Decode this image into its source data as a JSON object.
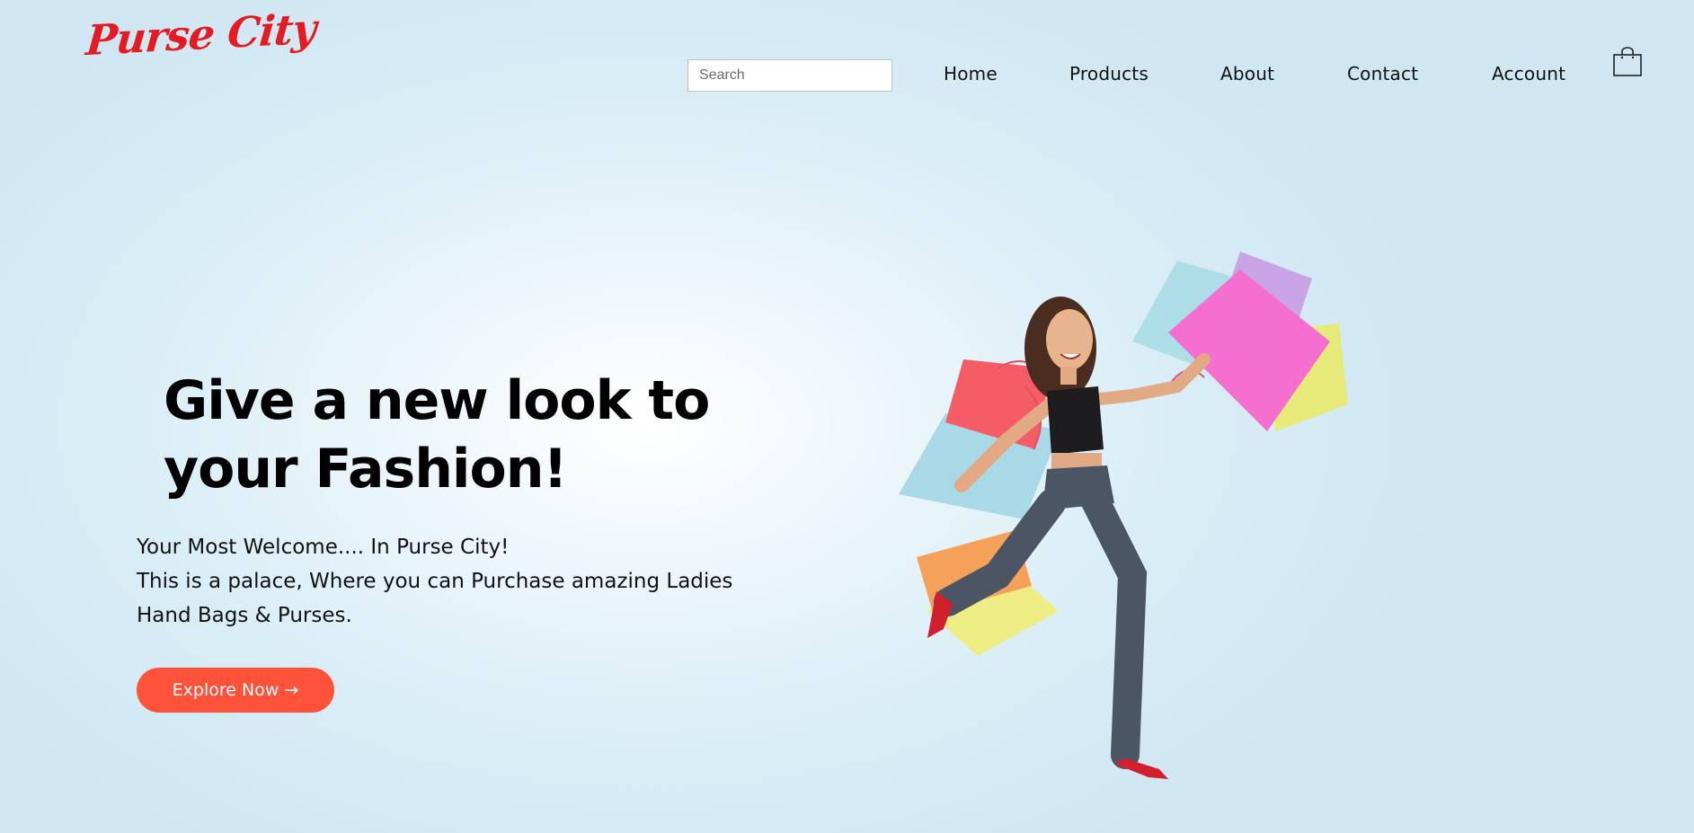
{
  "brand": {
    "name": "Purse City",
    "color": "#e41b23"
  },
  "search": {
    "placeholder": "Search",
    "value": ""
  },
  "nav": {
    "items": [
      {
        "label": "Home"
      },
      {
        "label": "Products"
      },
      {
        "label": "About"
      },
      {
        "label": "Contact"
      },
      {
        "label": "Account"
      }
    ]
  },
  "cart": {
    "icon": "shopping-bag-icon"
  },
  "hero": {
    "title_line1": "Give a new look to",
    "title_line2": "your Fashion!",
    "text_line1": "Your Most Welcome.... In Purse City!",
    "text_line2": "This is a palace, Where you can Purchase amazing Ladies",
    "text_line3": "Hand Bags & Purses.",
    "cta_label": "Explore Now →",
    "cta_color": "#ff523b",
    "image": "woman-with-shopping-bags"
  },
  "colors": {
    "background": "#d9edf6",
    "accent": "#ff523b",
    "brand": "#e41b23"
  }
}
